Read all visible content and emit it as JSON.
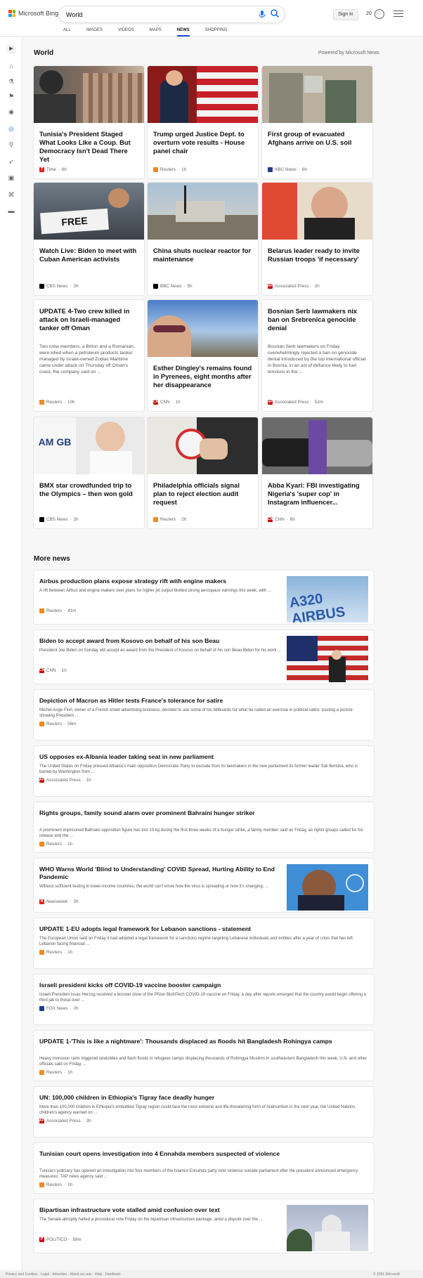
{
  "header": {
    "logo_text": "Microsoft Bing",
    "search_value": "World",
    "sign_in": "Sign in",
    "points": "20"
  },
  "scopes": [
    "ALL",
    "IMAGES",
    "VIDEOS",
    "MAPS",
    "NEWS",
    "SHOPPING"
  ],
  "active_scope": "NEWS",
  "sidebar": [
    "collapse",
    "home",
    "science",
    "sports",
    "flag",
    "location",
    "world",
    "science-ladder",
    "rocket",
    "tv",
    "bank",
    "card"
  ],
  "world": {
    "title": "World",
    "powered": "Powered by Microsoft News",
    "cards": [
      {
        "title": "Tunisia's President Staged What Looks Like a Coup. But Democracy Isn't Dead There Yet",
        "source": "Time",
        "time": "6h",
        "logo": "T",
        "logo_color": "#e0201a"
      },
      {
        "title": "Trump urged Justice Dept. to overturn vote results - House panel chair",
        "source": "Reuters",
        "time": "1h",
        "logo": "",
        "logo_color": "#f08a2b"
      },
      {
        "title": "First group of evacuated Afghans arrive on U.S. soil",
        "source": "NBC News",
        "time": "6h",
        "logo": "",
        "logo_color": "#1f3c88"
      },
      {
        "title": "Watch Live: Biden to meet with Cuban American activists",
        "source": "CBS News",
        "time": "2h",
        "logo": "",
        "logo_color": "#000000"
      },
      {
        "title": "China shuts nuclear reactor for maintenance",
        "source": "BBC News",
        "time": "5h",
        "logo": "",
        "logo_color": "#000000"
      },
      {
        "title": "Belarus leader ready to invite Russian troops 'if necessary'",
        "source": "Associated Press",
        "time": "2h",
        "logo": "AP",
        "logo_color": "#cc0000"
      },
      {
        "title": "UPDATE 4-Two crew killed in attack on Israeli-managed tanker off Oman",
        "desc": "Two crew members, a Briton and a Romanian, were killed when a petroleum products tanker managed by Israeli-owned Zodiac Maritime came under attack on Thursday off Oman's coast, the company said on ...",
        "source": "Reuters",
        "time": "10h",
        "logo": "",
        "logo_color": "#f08a2b"
      },
      {
        "title": "Esther Dingley's remains found in Pyrenees, eight months after her disappearance",
        "source": "CNN",
        "time": "1h",
        "logo": "CNN",
        "logo_color": "#cc0000"
      },
      {
        "title": "Bosnian Serb lawmakers nix ban on Srebrenica genocide denial",
        "desc": "Bosnian Serb lawmakers on Friday overwhelmingly rejected a ban on genocide denial introduced by the top international official in Bosnia, in an act of defiance likely to fuel tensions in the ...",
        "source": "Associated Press",
        "time": "52m",
        "logo": "AP",
        "logo_color": "#cc0000"
      },
      {
        "title": "BMX star crowdfunded trip to the Olympics – then won gold",
        "source": "CBS News",
        "time": "2h",
        "logo": "",
        "logo_color": "#000000"
      },
      {
        "title": "Philadelphia officials signal plan to reject election audit request",
        "source": "Reuters",
        "time": "2h",
        "logo": "",
        "logo_color": "#f08a2b"
      },
      {
        "title": "Abba Kyari: FBI investigating Nigeria's 'super cop' in Instagram influencer...",
        "source": "CNN",
        "time": "6h",
        "logo": "CNN",
        "logo_color": "#cc0000"
      }
    ]
  },
  "more_news": {
    "title": "More news",
    "items": [
      {
        "title": "Airbus production plans expose strategy rift with engine makers",
        "desc": "A rift between Airbus and engine makers over plans for higher jet output blotted strong aerospace earnings this week, with ...",
        "source": "Reuters",
        "time": "41m",
        "logo": "",
        "logo_color": "#f08a2b",
        "image": "airbus",
        "img_text": "A320 AIRBUS"
      },
      {
        "title": "Biden to accept award from Kosovo on behalf of his son Beau",
        "desc": "President Joe Biden on Sunday will accept an award from the President of Kosovo on behalf of his son Beau Biden for his work ...",
        "source": "CNN",
        "time": "1h",
        "logo": "CNN",
        "logo_color": "#cc0000",
        "image": "biden"
      },
      {
        "title": "Depiction of Macron as Hitler tests France's tolerance for satire",
        "desc": "Michel-Ange Flori, owner of a French street advertising business, decided to use some of his billboards for what he called an exercise in political satire: posting a picture showing President ...",
        "source": "Reuters",
        "time": "56m",
        "logo": "",
        "logo_color": "#f08a2b",
        "image": ""
      },
      {
        "title": "US opposes ex-Albania leader taking seat in new parliament",
        "desc": "The United States on Friday pressed Albania's main opposition Democratic Party to exclude from its lawmakers in the new parliament its former leader Sali Berisha, who is barred by Washington from ...",
        "source": "Associated Press",
        "time": "1h",
        "logo": "AP",
        "logo_color": "#cc0000",
        "image": ""
      },
      {
        "title": "Rights groups, family sound alarm over prominent Bahraini hunger striker",
        "desc": "A prominent imprisoned Bahraini opposition figure has lost 10 kg during the first three weeks of a hunger strike, a family member said on Friday, as rights groups called for his release and the ...",
        "source": "Reuters",
        "time": "1h",
        "logo": "",
        "logo_color": "#f08a2b",
        "image": ""
      },
      {
        "title": "WHO Warns World 'Blind to Understanding' COVID Spread, Hurting Ability to End Pandemic",
        "desc": "Without sufficient testing in lower-income countries, the world can't know how the virus is spreading or how it's changing, ...",
        "source": "Newsweek",
        "time": "2h",
        "logo": "N",
        "logo_color": "#e0201a",
        "image": "who"
      },
      {
        "title": "UPDATE 1-EU adopts legal framework for Lebanon sanctions - statement",
        "desc": "The European Union said on Friday it had adopted a legal framework for a sanctions regime targeting Lebanese individuals and entities after a year of crisis that has left Lebanon facing financial ...",
        "source": "Reuters",
        "time": "1h",
        "logo": "",
        "logo_color": "#f08a2b",
        "image": ""
      },
      {
        "title": "Israeli president kicks off COVID-19 vaccine booster campaign",
        "desc": "Israeli President Issac Herzog received a booster dose of the Pfizer-BioNTech COVID-19 vaccine on Friday, a day after reports emerged that the country would begin offering a third jab to those over ...",
        "source": "FOX News",
        "time": "2h",
        "logo": "",
        "logo_color": "#1f3c88",
        "image": ""
      },
      {
        "title": "UPDATE 1-'This is like a nightmare': Thousands displaced as floods hit Bangladesh Rohingya camps",
        "desc": "Heavy monsoon rains triggered landslides and flash floods in refugees camps displacing thousands of Rohingya Muslims in southeastern Bangladesh this week, U.N. and other officials said on Friday, ...",
        "source": "Reuters",
        "time": "1h",
        "logo": "",
        "logo_color": "#f08a2b",
        "image": ""
      },
      {
        "title": "UN: 100,000 children in Ethiopia's Tigray face deadly hunger",
        "desc": "More than 100,000 children in Ethiopia's embattled Tigray region could face the most extreme and life-threatening form of malnutrition in the next year, the United Nations children's agency warned on ...",
        "source": "Associated Press",
        "time": "3h",
        "logo": "AP",
        "logo_color": "#cc0000",
        "image": ""
      },
      {
        "title": "Tunisian court opens investigation into 4 Ennahda members suspected of violence",
        "desc": "Tunisia's judiciary has opened an investigation into four members of the Islamist Ennahda party over violence outside parliament after the president announced emergency measures, TAP news agency said ...",
        "source": "Reuters",
        "time": "1h",
        "logo": "",
        "logo_color": "#f08a2b",
        "image": ""
      },
      {
        "title": "Bipartisan infrastructure vote stalled amid confusion over text",
        "desc": "The Senate abruptly halted a procedural vote Friday on the bipartisan infrastructure package, amid a dispute over the ...",
        "source": "POLITICO",
        "time": "58m",
        "logo": "P",
        "logo_color": "#d0021b",
        "image": "capitol"
      }
    ]
  },
  "footer": {
    "left": "Privacy and Cookies · Legal · Advertise · About our ads · Help · Feedback",
    "right": "© 2021 Microsoft"
  }
}
